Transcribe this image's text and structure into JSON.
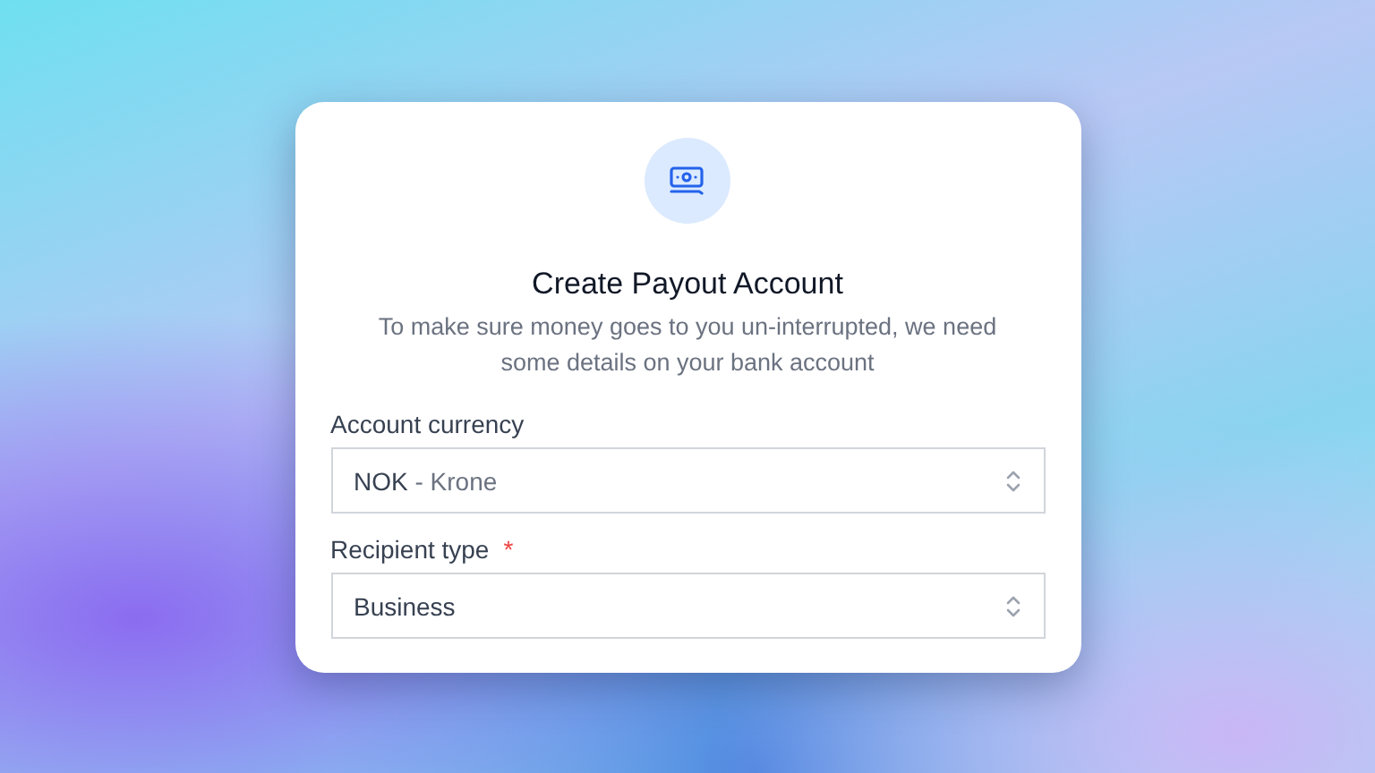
{
  "dialog": {
    "title": "Create Payout Account",
    "description": "To make sure money goes to you un-interrupted, we need some details on your bank account"
  },
  "fields": [
    {
      "label": "Account currency",
      "value": "NOK",
      "detail": "- Krone"
    },
    {
      "label": "Recipient type",
      "required_mark": "*",
      "value": "Business"
    }
  ]
}
